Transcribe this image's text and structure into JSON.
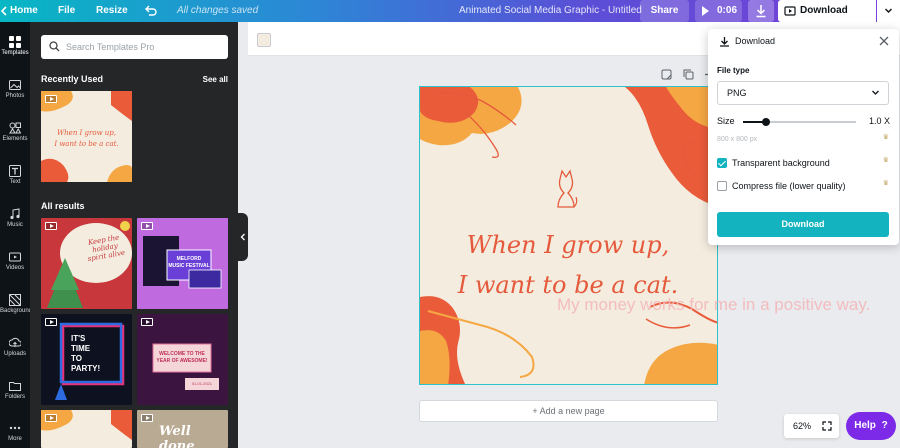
{
  "topbar": {
    "home": "Home",
    "file": "File",
    "resize": "Resize",
    "save_status": "All changes saved",
    "doc_title": "Animated Social Media Graphic - Untitled",
    "share": "Share",
    "duration": "0:06",
    "download_video": "Download Video"
  },
  "rail": [
    {
      "label": "Templates",
      "icon": "templates-icon"
    },
    {
      "label": "Photos",
      "icon": "photos-icon"
    },
    {
      "label": "Elements",
      "icon": "elements-icon"
    },
    {
      "label": "Text",
      "icon": "text-icon"
    },
    {
      "label": "Music",
      "icon": "music-icon"
    },
    {
      "label": "Videos",
      "icon": "videos-icon"
    },
    {
      "label": "Background",
      "icon": "background-icon"
    },
    {
      "label": "Uploads",
      "icon": "uploads-icon"
    },
    {
      "label": "Folders",
      "icon": "folders-icon"
    },
    {
      "label": "More",
      "icon": "more-icon"
    }
  ],
  "panel": {
    "search_placeholder": "Search Templates Pro",
    "recently_used": "Recently Used",
    "see_all": "See all",
    "all_results": "All results",
    "thumbs": {
      "recent_line1": "When I grow up,",
      "recent_line2": "I want to be a cat.",
      "holiday_line1": "Keep the",
      "holiday_line2": "holiday",
      "holiday_line3": "spirit alive",
      "festival_line1": "MELFORD",
      "festival_line2": "MUSIC FESTIVAL",
      "party_line1": "IT'S",
      "party_line2": "TIME",
      "party_line3": "TO",
      "party_line4": "PARTY!",
      "awesome_line1": "WELCOME TO THE",
      "awesome_line2": "YEAR OF AWESOME!",
      "awesome_date": "01.01.2021",
      "welldone": "Well done"
    }
  },
  "canvas": {
    "line1": "When I grow up,",
    "line2": "I want to be a cat.",
    "add_page": "+ Add a new page",
    "watermark": "My money works for me in a positive way."
  },
  "download_panel": {
    "title": "Download",
    "file_type_label": "File type",
    "file_type_value": "PNG",
    "size_label": "Size",
    "size_value": "1.0",
    "size_unit": "X",
    "dimensions": "800 x 800 px",
    "size_fraction": 0.2,
    "transparent_label": "Transparent background",
    "transparent_checked": true,
    "compress_label": "Compress file (lower quality)",
    "compress_checked": false,
    "download_button": "Download"
  },
  "zoom": "62%",
  "help": "Help",
  "colors": {
    "accent": "#13b3c0",
    "canvas_bg": "#f4ecdf",
    "canvas_text": "#e55a3c",
    "help_purple": "#7d2ae8"
  }
}
